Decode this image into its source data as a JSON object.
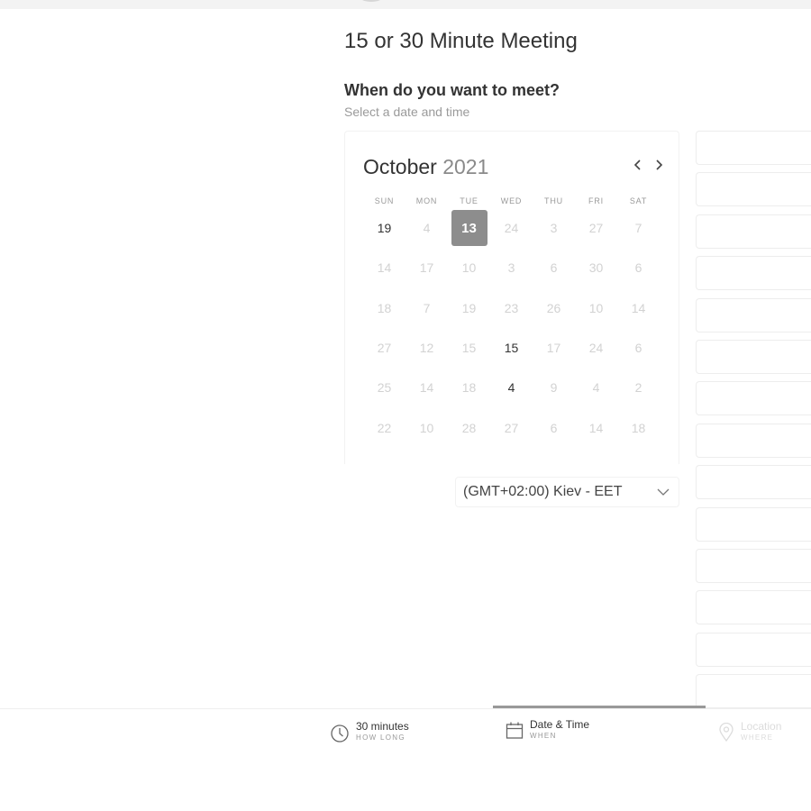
{
  "event": {
    "title": "15 or 30 Minute Meeting",
    "question": "When do you want to meet?",
    "subtext": "Select a date and time"
  },
  "calendar": {
    "month": "October",
    "year": "2021",
    "prev_icon": "chevron-left-icon",
    "next_icon": "chevron-right-icon",
    "weekdays": [
      "SUN",
      "MON",
      "TUE",
      "WED",
      "THU",
      "FRI",
      "SAT"
    ],
    "selected": "13",
    "weeks": [
      [
        "19",
        "4",
        "13",
        "24",
        "3",
        "27",
        "7"
      ],
      [
        "14",
        "17",
        "10",
        "3",
        "6",
        "30",
        "6"
      ],
      [
        "18",
        "7",
        "19",
        "23",
        "26",
        "10",
        "14"
      ],
      [
        "27",
        "12",
        "15",
        "15",
        "17",
        "24",
        "6"
      ],
      [
        "25",
        "14",
        "18",
        "4",
        "9",
        "4",
        "2"
      ],
      [
        "22",
        "10",
        "28",
        "27",
        "6",
        "14",
        "18"
      ]
    ],
    "available": [
      [
        0,
        0
      ],
      [
        0,
        2
      ],
      [
        3,
        3
      ],
      [
        4,
        3
      ]
    ]
  },
  "timezone": {
    "value": "(GMT+02:00) Kiev - EET",
    "icon": "chevron-down-icon"
  },
  "time_slots_count": 14,
  "steps": [
    {
      "label": "30 minutes",
      "sub": "HOW LONG",
      "icon": "clock-icon",
      "state": "done"
    },
    {
      "label": "Date & Time",
      "sub": "WHEN",
      "icon": "calendar-icon",
      "state": "active"
    },
    {
      "label": "Location",
      "sub": "WHERE",
      "icon": "location-pin-icon",
      "state": "disabled"
    }
  ],
  "progress": {
    "active_step": 2,
    "total_steps": 3
  },
  "colors": {
    "selected_day": "#8d8d8d",
    "progress_bar": "#999999",
    "muted_day": "#d2d2d2"
  }
}
